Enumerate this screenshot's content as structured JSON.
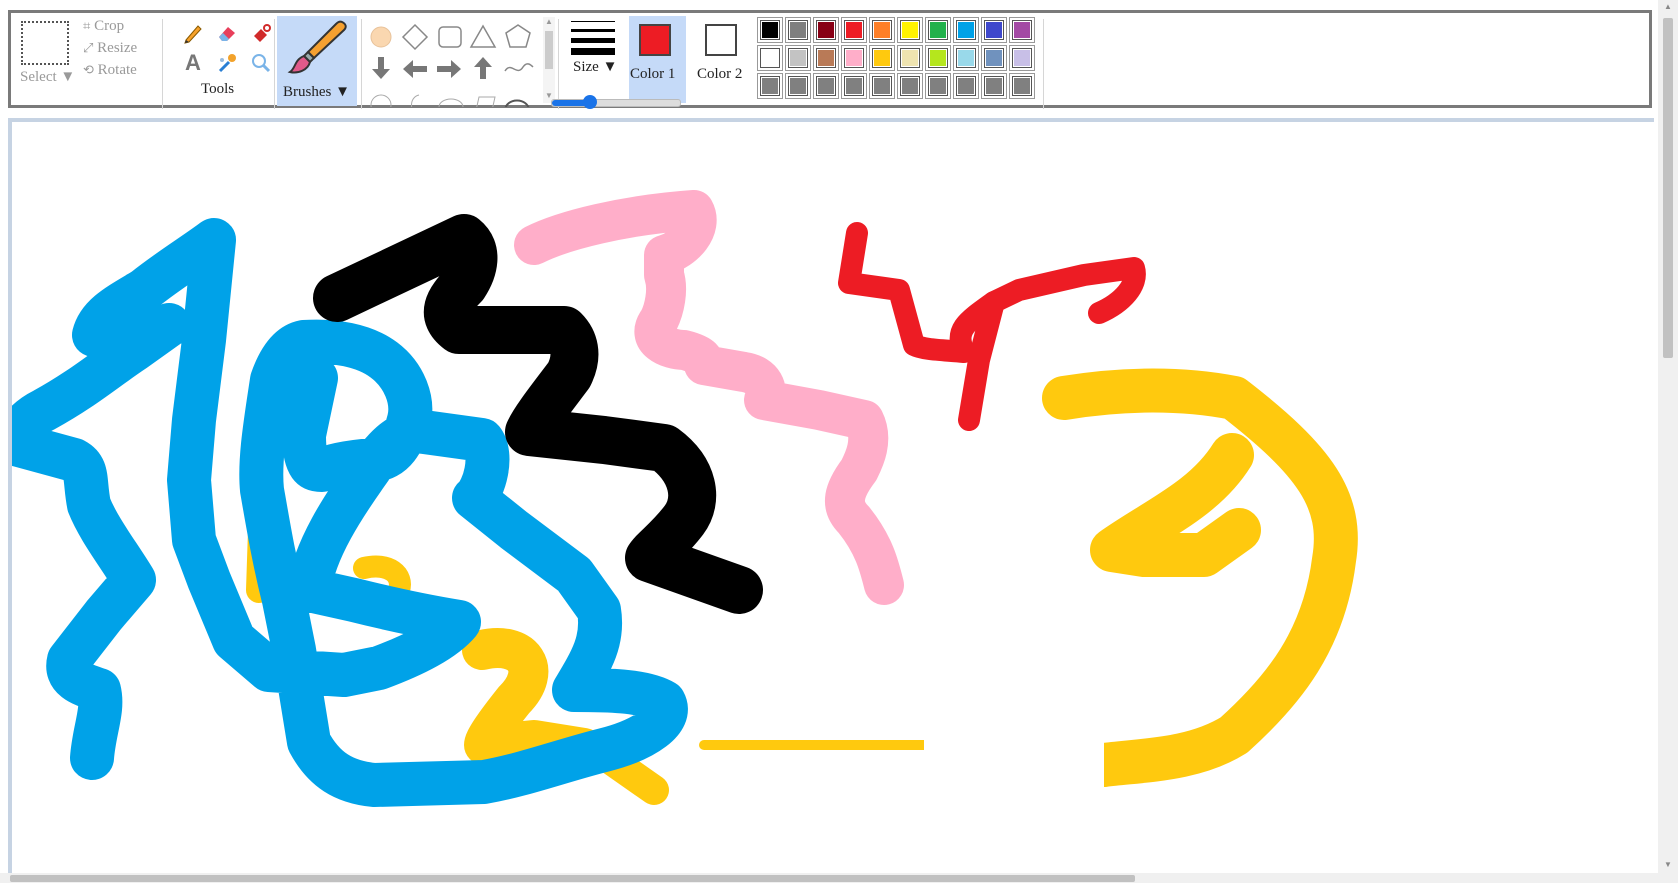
{
  "ribbon": {
    "select_label": "Select ▼",
    "image_tools": [
      "Crop",
      "Resize",
      "Rotate"
    ],
    "tools_label": "Tools",
    "brushes_label": "Brushes ▼",
    "size_label": "Size ▼",
    "color1_label": "Color 1",
    "color2_label": "Color 2",
    "brush_size": 0.3
  },
  "colors": {
    "color1": "#ed1c24",
    "color2": "#ffffff",
    "palette_row1": [
      "#000000",
      "#7f7f7f",
      "#880015",
      "#ed1c24",
      "#ff7f27",
      "#fff200",
      "#22b14c",
      "#00a2e8",
      "#3f48cc",
      "#a349a4"
    ],
    "palette_row2": [
      "#ffffff",
      "#c3c3c3",
      "#b97a57",
      "#ffaec9",
      "#ffc90e",
      "#efe4b0",
      "#b5e61d",
      "#99d9ea",
      "#7092be",
      "#c8bfe7"
    ],
    "palette_row3": [
      "#808080",
      "#808080",
      "#808080",
      "#808080",
      "#808080",
      "#808080",
      "#808080",
      "#808080",
      "#808080",
      "#808080"
    ]
  },
  "icons": {
    "select": "dotted-rectangle",
    "tools": [
      "pencil-icon",
      "eraser-icon",
      "fill-bucket-icon",
      "text-icon",
      "color-picker-icon",
      "magnifier-icon"
    ],
    "brush": "paintbrush-icon",
    "shapes": [
      "oval-icon",
      "diamond-icon",
      "rounded-rect-icon",
      "triangle-icon",
      "pentagon-icon",
      "arrow-down-icon",
      "arrow-left-icon",
      "arrow-right-icon",
      "arrow-up-icon",
      "curve-icon",
      "circle-icon",
      "moon-icon",
      "ellipse-icon",
      "parallelogram-icon",
      "arc-icon"
    ]
  }
}
